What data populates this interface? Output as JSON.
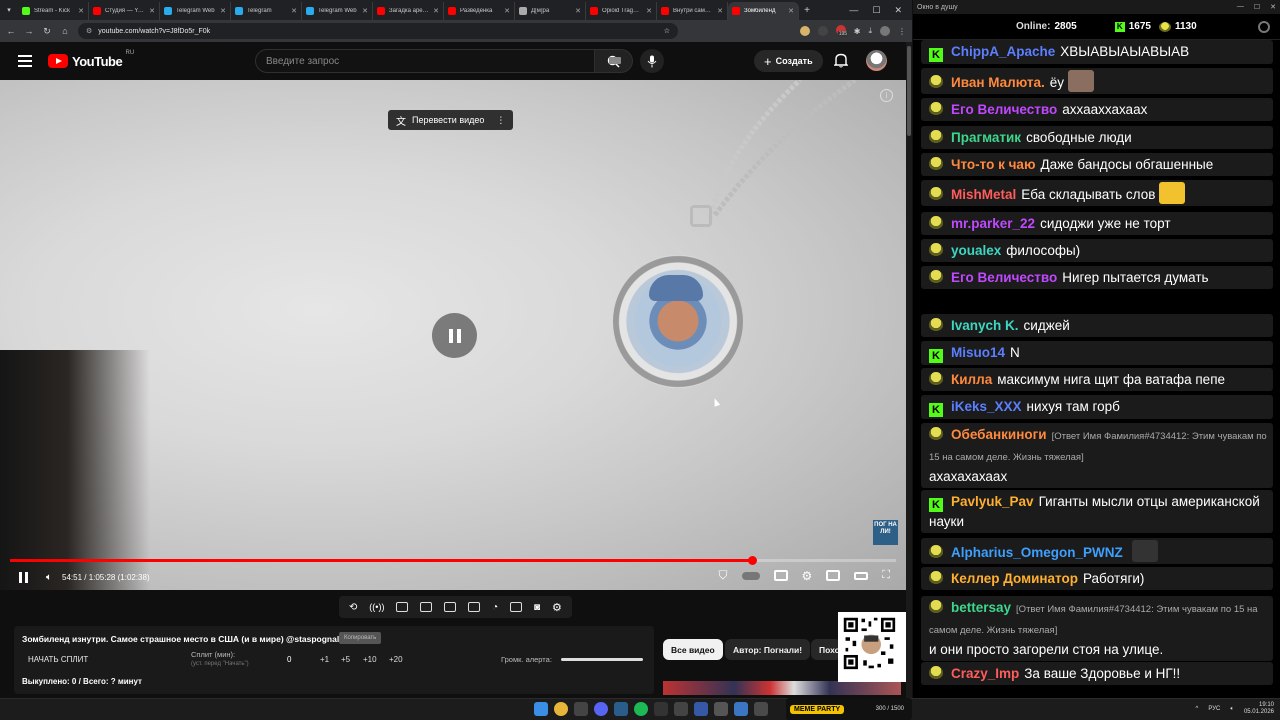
{
  "browser": {
    "tabs": [
      {
        "title": "Stream - Kick",
        "color": "#53fc18"
      },
      {
        "title": "Студия — YouTube",
        "color": "#ff0000"
      },
      {
        "title": "Telegram Web",
        "color": "#2aabee"
      },
      {
        "title": "Telegram",
        "color": "#2aabee"
      },
      {
        "title": "Telegram Web",
        "color": "#2aabee"
      },
      {
        "title": "Загадка арестанта",
        "color": "#ff0000"
      },
      {
        "title": "Разведенка",
        "color": "#ff0000"
      },
      {
        "title": "Д[м]ра",
        "color": "#aaaaaa"
      },
      {
        "title": "Opioid Tragedy",
        "color": "#ff0000"
      },
      {
        "title": "Внутри самого",
        "color": "#ff0000"
      },
      {
        "title": "Зомбиленд",
        "color": "#ff0000"
      }
    ],
    "url": "youtube.com/watch?v=J8fDo5r_F0k",
    "ext_badge": "195"
  },
  "youtube": {
    "logo_text": "YouTube",
    "country_code": "RU",
    "search_placeholder": "Введите запрос",
    "create_label": "Создать",
    "translate_label": "Перевести видео",
    "watermark_text": "ПОГ НА ЛИ!",
    "time_display": "54:51 / 1:05:28 (1:02:38)",
    "progress_fraction": 0.838,
    "video_title": "Зомбиленд изнутри. Самое страшное место в США (и в мире) @staspognali",
    "title_badge": "Копировать",
    "chips": [
      "Все видео",
      "Автор: Погнали!",
      "Похожие"
    ]
  },
  "split_panel": {
    "start_label": "НАЧАТЬ СПЛИТ",
    "split_label": "Сплит (мин):",
    "split_hint": "(уст. перед \"Начать\")",
    "split_value": "0",
    "increments": [
      "+1",
      "+5",
      "+10",
      "+20"
    ],
    "alert_label": "Громк. алерта:",
    "bought": "Выкуплено: 0 / Всего: ? минут"
  },
  "chat": {
    "window_title": "Окно в душу",
    "online_label": "Online:",
    "online_count": "2805",
    "kick_count": "1675",
    "trovo_count": "1130",
    "messages": [
      {
        "platform": "kick",
        "nick": "ChippA_Apache",
        "color": "#5b7fff",
        "text": "ХВЫАВЫАЫАВЫАВ"
      },
      {
        "platform": "trovo",
        "nick": "Иван Малюта.",
        "color": "#ff8a3d",
        "text": "ёу",
        "emote": true
      },
      {
        "platform": "trovo",
        "nick": "Его Величество",
        "color": "#c048ff",
        "text": "аххааххахаах"
      },
      {
        "platform": "trovo",
        "nick": "Прагматик",
        "color": "#3dd68c",
        "text": "свободные люди"
      },
      {
        "platform": "trovo",
        "nick": "Что-то к чаю",
        "color": "#ff8a3d",
        "text": "Даже бандосы обгашенные"
      },
      {
        "platform": "trovo",
        "nick": "MishMetal",
        "color": "#ff5c5c",
        "text": "Еба складывать слов",
        "emote": true
      },
      {
        "platform": "trovo",
        "nick": "mr.parker_22",
        "color": "#c048ff",
        "text": "сидоджи уже не торт"
      },
      {
        "platform": "trovo",
        "nick": "youalex",
        "color": "#3dd6c0",
        "text": "философы)"
      },
      {
        "platform": "trovo",
        "nick": "Его Величество",
        "color": "#c048ff",
        "text": "Нигер пытается думать"
      },
      {
        "platform": "trovo",
        "nick": "Ivanych K.",
        "color": "#3dd6c0",
        "text": "сиджей"
      },
      {
        "platform": "kick",
        "nick": "Misuo14",
        "color": "#5b7fff",
        "text": "N"
      },
      {
        "platform": "trovo",
        "nick": "Килла",
        "color": "#ff8a3d",
        "text": "максимум нига щит фа ватафа пепе"
      },
      {
        "platform": "kick",
        "nick": "iKeks_XXX",
        "color": "#5b7fff",
        "text": "нихуя там горб"
      },
      {
        "platform": "trovo",
        "nick": "Обебанкиноги",
        "color": "#ff8a3d",
        "reply": "[Ответ Имя Фамилия#4734412: Этим чувакам по 15 на самом деле. Жизнь тяжелая]",
        "text": "ахахахахаах"
      },
      {
        "platform": "kick",
        "nick": "Pavlyuk_Pav",
        "color": "#ffb02e",
        "text": "Гиганты мысли отцы американской науки"
      },
      {
        "platform": "trovo",
        "nick": "Alpharius_Omegon_PWNZ",
        "color": "#3da0ff",
        "text": "",
        "emote": true
      },
      {
        "platform": "trovo",
        "nick": "Келлер Доминатор",
        "color": "#ffb02e",
        "text": "Работяги)"
      },
      {
        "platform": "trovo",
        "nick": "bettersay",
        "color": "#3dd68c",
        "reply": "[Ответ Имя Фамилия#4734412: Этим чувакам по 15 на самом деле. Жизнь тяжелая]",
        "text": "и они просто загорели стоя на улице."
      },
      {
        "platform": "trovo",
        "nick": "Crazy_Imp",
        "color": "#ff5c5c",
        "text": "За ваше Здоровье и НГ!!"
      }
    ]
  },
  "taskbar": {
    "meme_logo": "MEME PARTY",
    "meme_score": "300 / 1500",
    "lang": "РУС",
    "time": "19:10",
    "date": "05.01.2026"
  }
}
